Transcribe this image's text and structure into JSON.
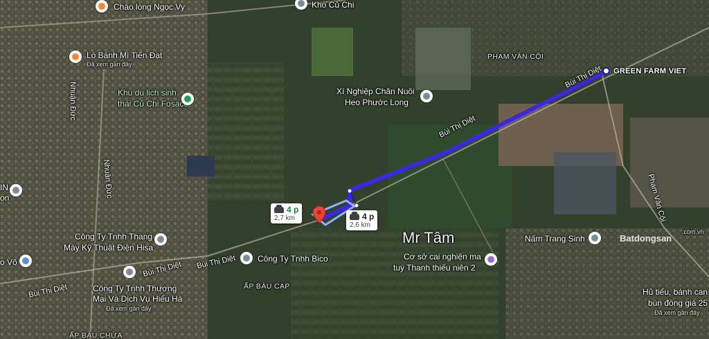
{
  "places": {
    "chao_long": "Cháo lòng Ngọc Vy",
    "kho_cu_chi": "Kho Củ Chi",
    "lo_banh_mi": "Lò Bánh Mì Tiến Đạt",
    "lo_banh_mi_sub": "Đã xem gần đây",
    "khu_du_lich_1": "Khu du lịch sinh",
    "khu_du_lich_2": "thái Củ Chi Fosaco",
    "xi_nghiep_1": "Xí Nghiệp Chăn Nuôi",
    "xi_nghiep_2": "Heo Phước Long",
    "pham_van_coi_area": "PHẠM VĂN CỘI",
    "green_farm": "GREEN FARM VIET",
    "cong_ty_thang_1": "Công Ty Tnhh Thang",
    "cong_ty_thang_2": "Máy Kỹ Thuật Điện Hisa",
    "cong_ty_bico": "Công Ty Tnhh Bico",
    "cong_ty_hieu_ha_1": "Công Ty Tnhh Thương",
    "cong_ty_hieu_ha_2": "Mại Và Dịch Vụ Hiếu Hà",
    "cong_ty_hieu_ha_sub": "Đã xem gần đây",
    "ap_bau_cap": "ẤP BÀU CẠP",
    "ap_bau_chua": "ẤP BÀU CHỨA",
    "mr_tam": "Mr Tâm",
    "co_so_1": "Cơ sở cai nghiện ma",
    "co_so_2": "tuý Thanh thiếu niên 2",
    "nam_trang_sinh": "Nấm Trang Sinh",
    "hu_tieu_1": "Hủ tiếu, bánh can",
    "hu_tieu_2": "bún đồng giá 25",
    "hu_tieu_sub": "Đã xem gần đây",
    "left_edge_1": "IN",
    "left_edge_2": "on",
    "left_edge_vo": "o Võ"
  },
  "roads": {
    "bui_thi_diet_1": "Bùi Thị Diệt",
    "bui_thi_diet_2": "Bùi Thị Diệt",
    "bui_thi_diet_3": "Bùi Thị Diệt",
    "bui_thi_diet_4": "Bùi Thị Diệt",
    "bui_thi_diet_5": "Bùi Thị Diệt",
    "nhuan_duc_1": "Nhuận Đức",
    "nhuan_duc_2": "Nhuận Đức",
    "pham_van_coi_road": "Phạm Văn Cội"
  },
  "route_badges": {
    "a_time": "4 p",
    "a_dist": "2,7 km",
    "b_time": "4 p",
    "b_dist": "2,6 km"
  },
  "watermark": {
    "text": "Batdongsan",
    "suffix": ".com.vn"
  },
  "colors": {
    "route": "#3b28e6",
    "route_alt": "#8fb4ff",
    "destination_pin": "#ea4335"
  }
}
